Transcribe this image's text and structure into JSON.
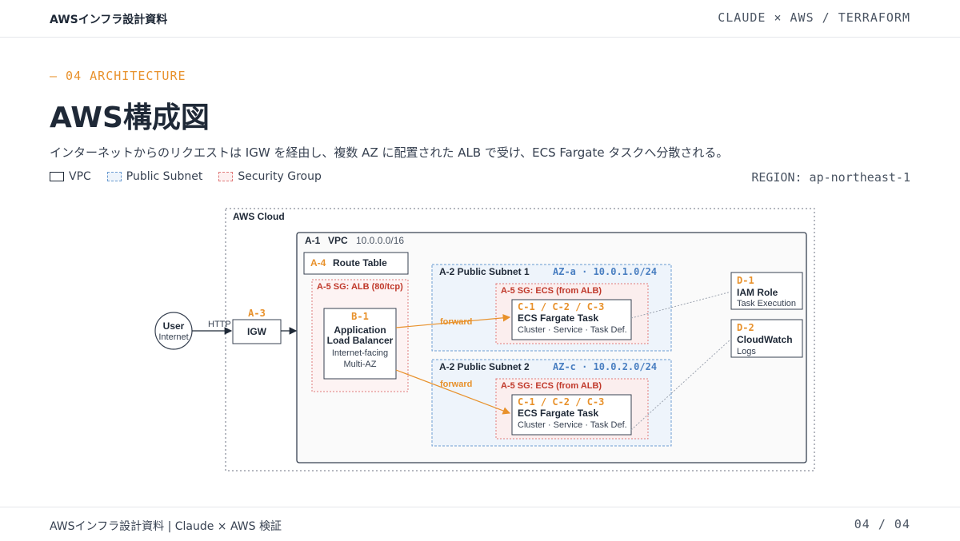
{
  "header": {
    "doc_title": "AWSインフラ設計資料",
    "right_label": "CLAUDE × AWS / TERRAFORM"
  },
  "section_label": "— 04  ARCHITECTURE",
  "page_title": "AWS構成図",
  "description": "インターネットからのリクエストは IGW を経由し、複数 AZ に配置された ALB で受け、ECS Fargate タスクへ分散される。",
  "legend": [
    {
      "label": "VPC"
    },
    {
      "label": "Public Subnet"
    },
    {
      "label": "Security Group"
    }
  ],
  "region_label": "REGION: ap-northeast-1",
  "diagram": {
    "cloud_label": "AWS Cloud",
    "vpc": {
      "id": "A-1",
      "name": "VPC",
      "cidr": "10.0.0.0/16"
    },
    "route_table": {
      "id": "A-4",
      "name": "Route Table"
    },
    "sg_alb": "A-5 SG: ALB (80/tcp)",
    "alb": {
      "id": "B-1",
      "line1": "Application",
      "line2": "Load Balancer",
      "line3": "Internet-facing",
      "line4": "Multi-AZ"
    },
    "user": {
      "line1": "User",
      "line2": "Internet"
    },
    "http_label": "HTTP",
    "igw": {
      "id": "A-3",
      "name": "IGW"
    },
    "subnet1": {
      "name": "A-2 Public Subnet 1",
      "az": "AZ-a · 10.0.1.0/24"
    },
    "subnet2": {
      "name": "A-2 Public Subnet 2",
      "az": "AZ-c · 10.0.2.0/24"
    },
    "sg_ecs": "A-5 SG: ECS (from ALB)",
    "task": {
      "id": "C-1 / C-2 / C-3",
      "name": "ECS Fargate Task",
      "sub": "Cluster · Service · Task Def."
    },
    "forward_label": "forward",
    "iam": {
      "id": "D-1",
      "name": "IAM Role",
      "sub": "Task Execution"
    },
    "cloudwatch": {
      "id": "D-2",
      "name": "CloudWatch",
      "sub": "Logs"
    }
  },
  "footer": {
    "left": "AWSインフラ設計資料 | Claude × AWS 検証",
    "page": "04 / 04"
  },
  "colors": {
    "accent": "#e8912b",
    "subnet_blue": "#4a7fc1",
    "sg_red": "#c0392b",
    "text": "#1f2937"
  }
}
